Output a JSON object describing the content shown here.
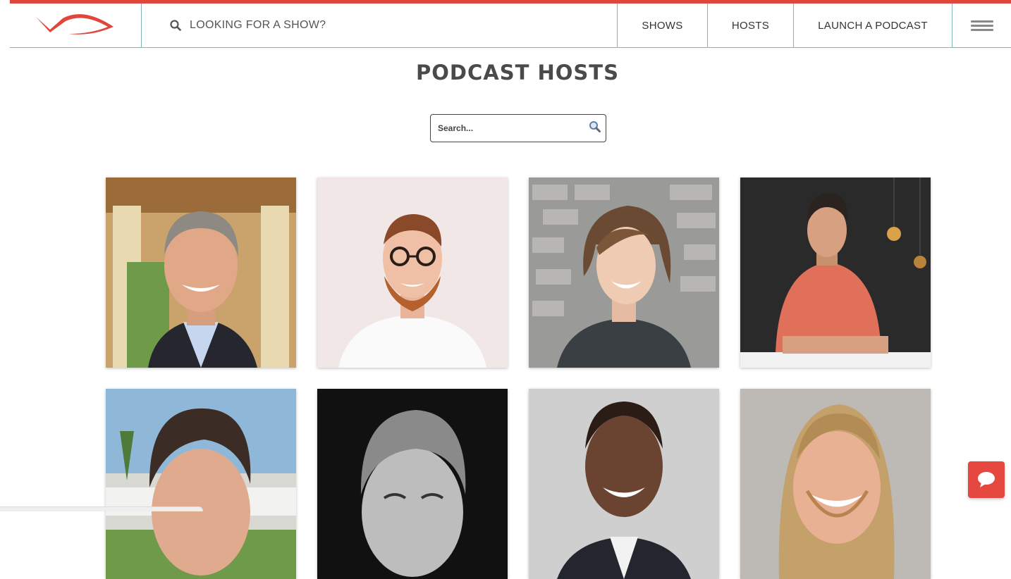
{
  "header": {
    "search_prompt": "LOOKING FOR A SHOW?",
    "nav": [
      "SHOWS",
      "HOSTS",
      "LAUNCH A PODCAST"
    ]
  },
  "page": {
    "title": "PODCAST HOSTS",
    "search_placeholder": "Search..."
  },
  "colors": {
    "accent": "#e0463c",
    "divider": "#7fb3c1"
  },
  "hosts": [
    {
      "portrait": "man-grey-hair-dark-suit",
      "bg": "#c9a36b"
    },
    {
      "portrait": "man-glasses-red-beard",
      "bg": "#f1e7e7"
    },
    {
      "portrait": "woman-brown-bob-hair",
      "bg": "#9a9a98"
    },
    {
      "portrait": "man-red-tshirt-dark-room",
      "bg": "#2a2a2a"
    },
    {
      "portrait": "man-dark-hair-outdoors",
      "bg": "#8fb8d8"
    },
    {
      "portrait": "man-grey-hair-black-white",
      "bg": "#1a1a1a"
    },
    {
      "portrait": "man-bald-suit",
      "bg": "#cfcfcf"
    },
    {
      "portrait": "man-long-blond-hair",
      "bg": "#bdbab5"
    }
  ],
  "icons": {
    "logo": "brand-swoosh-logo",
    "search": "search-icon",
    "menu": "hamburger-menu-icon",
    "chat": "chat-bubble-icon"
  }
}
